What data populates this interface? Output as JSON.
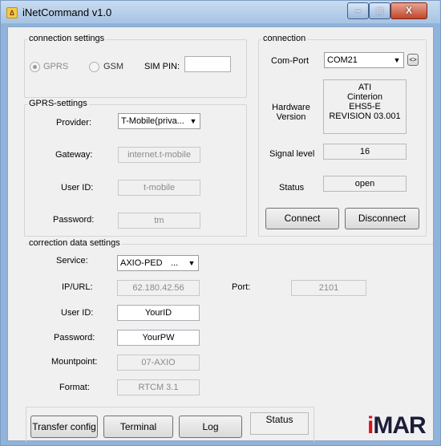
{
  "window": {
    "title": "iNetCommand v1.0",
    "app_icon": "app-icon",
    "controls": {
      "minimize": "–",
      "maximize": "□",
      "close": "X"
    }
  },
  "connection_settings": {
    "title": "connection settings",
    "gprs_label": "GPRS",
    "gsm_label": "GSM",
    "sim_pin_label": "SIM PIN:",
    "sim_pin_value": ""
  },
  "gprs_settings": {
    "title": "GPRS-settings",
    "provider_label": "Provider:",
    "provider_value": "T-Mobile(priva...",
    "gateway_label": "Gateway:",
    "gateway_value": "internet.t-mobile",
    "user_id_label": "User ID:",
    "user_id_value": "t-mobile",
    "password_label": "Password:",
    "password_value": "tm"
  },
  "connection": {
    "title": "connection",
    "comport_label": "Com-Port",
    "comport_value": "COM21",
    "refresh_label": "<>",
    "hardware_label_1": "Hardware",
    "hardware_label_2": "Version",
    "hardware_lines": [
      "ATI",
      "Cinterion",
      "EHS5-E",
      "REVISION 03.001"
    ],
    "signal_label": "Signal level",
    "signal_value": "16",
    "status_label": "Status",
    "status_value": "open",
    "connect_label": "Connect",
    "disconnect_label": "Disconnect"
  },
  "correction": {
    "title": "correction data settings",
    "service_label": "Service:",
    "service_value": "AXIO-PED",
    "service_ellipsis": "...",
    "ipurl_label": "IP/URL:",
    "ipurl_value": "62.180.42.56",
    "port_label": "Port:",
    "port_value": "2101",
    "user_id_label": "User ID:",
    "user_id_value": "YourID",
    "password_label": "Password:",
    "password_value": "YourPW",
    "mountpoint_label": "Mountpoint:",
    "mountpoint_value": "07-AXIO",
    "format_label": "Format:",
    "format_value": "RTCM 3.1"
  },
  "bottom": {
    "transfer_label": "Transfer config",
    "terminal_label": "Terminal",
    "log_label": "Log",
    "status_label": "Status",
    "logo_i": "i",
    "logo_rest": "MAR"
  },
  "colors": {
    "logo_red": "#d4141b",
    "logo_dark": "#1c1c3a"
  }
}
